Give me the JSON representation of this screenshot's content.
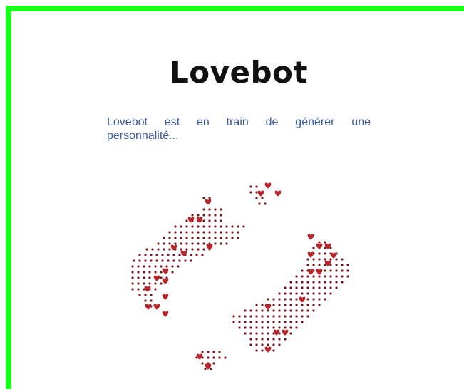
{
  "app": {
    "title": "Lovebot"
  },
  "status": {
    "message": "Lovebot est en train de générer une personnalité..."
  },
  "loader": {
    "icon": "refresh-hearts-icon"
  },
  "colors": {
    "frame_border": "#1aff1a",
    "title_text": "#111111",
    "message_text": "#3b5aa3",
    "heart": "#b5272d",
    "dot": "#7a1b1b"
  }
}
